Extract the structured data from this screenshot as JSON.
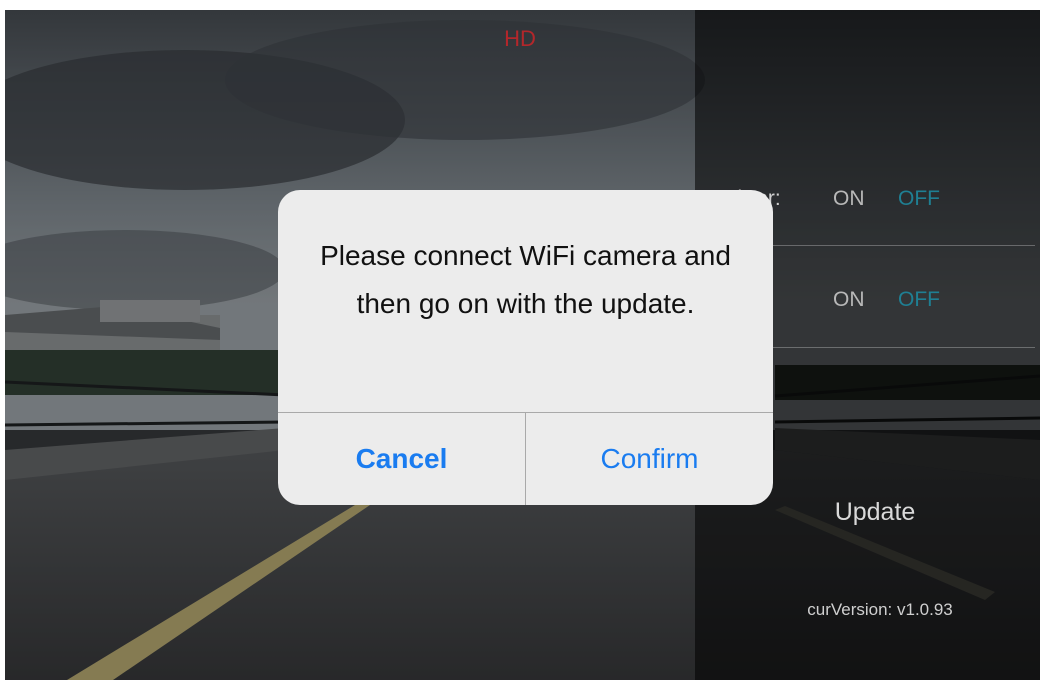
{
  "preview": {
    "resolution_label": "HD"
  },
  "settings": {
    "rows": [
      {
        "label": "Mirror:",
        "on_label": "ON",
        "off_label": "OFF"
      },
      {
        "label": "",
        "on_label": "ON",
        "off_label": "OFF"
      }
    ],
    "update_label": "Update",
    "version_text": "curVersion: v1.0.93"
  },
  "dialog": {
    "message": "Please connect WiFi camera and then go on with the update.",
    "cancel_label": "Cancel",
    "confirm_label": "Confirm"
  },
  "colors": {
    "accent_blue": "#1a7cf0",
    "off_teal": "#1f7f93",
    "hd_red": "#b3272b"
  }
}
